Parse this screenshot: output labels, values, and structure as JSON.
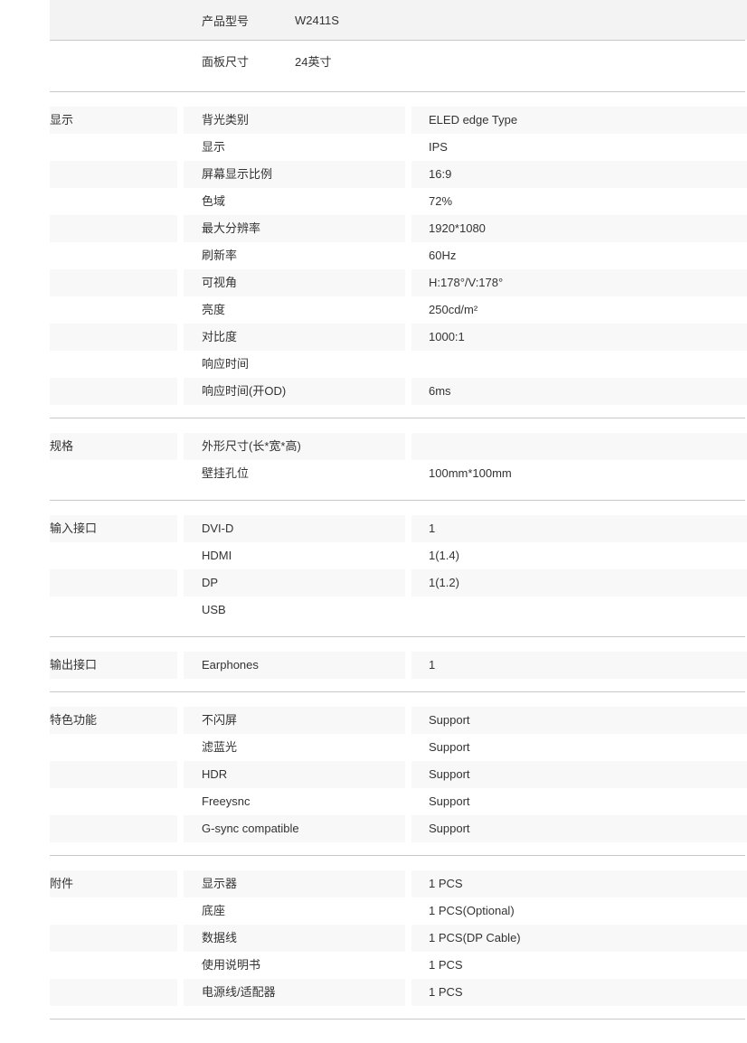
{
  "product": {
    "model_label": "产品型号",
    "model_value": "W2411S",
    "panel_size_label": "面板尺寸",
    "panel_size_value": "24英寸"
  },
  "sections": [
    {
      "group": "显示",
      "rows": [
        {
          "label": "背光类别",
          "value": "ELED edge Type"
        },
        {
          "label": "显示",
          "value": "IPS"
        },
        {
          "label": "屏幕显示比例",
          "value": "16:9"
        },
        {
          "label": "色域",
          "value": "72%"
        },
        {
          "label": "最大分辨率",
          "value": "1920*1080"
        },
        {
          "label": "刷新率",
          "value": "60Hz"
        },
        {
          "label": "可视角",
          "value": "H:178°/V:178°"
        },
        {
          "label": "亮度",
          "value": "250cd/m²"
        },
        {
          "label": "对比度",
          "value": "1000:1"
        },
        {
          "label": "响应时间",
          "value": ""
        },
        {
          "label": "响应时间(开OD)",
          "value": "6ms"
        }
      ]
    },
    {
      "group": "规格",
      "rows": [
        {
          "label": "外形尺寸(长*宽*高)",
          "value": ""
        },
        {
          "label": "壁挂孔位",
          "value": "100mm*100mm"
        }
      ]
    },
    {
      "group": "输入接口",
      "rows": [
        {
          "label": "DVI-D",
          "value": "1"
        },
        {
          "label": "HDMI",
          "value": "1(1.4)"
        },
        {
          "label": "DP",
          "value": "1(1.2)"
        },
        {
          "label": "USB",
          "value": ""
        }
      ]
    },
    {
      "group": "输出接口",
      "rows": [
        {
          "label": "Earphones",
          "value": "1"
        }
      ]
    },
    {
      "group": "特色功能",
      "rows": [
        {
          "label": "不闪屏",
          "value": "Support"
        },
        {
          "label": "滤蓝光",
          "value": "Support"
        },
        {
          "label": "HDR",
          "value": "Support"
        },
        {
          "label": "Freeysnc",
          "value": "Support"
        },
        {
          "label": "G-sync compatible",
          "value": "Support"
        }
      ]
    },
    {
      "group": "附件",
      "rows": [
        {
          "label": "显示器",
          "value": "1 PCS"
        },
        {
          "label": "底座",
          "value": "1 PCS(Optional)"
        },
        {
          "label": "数据线",
          "value": "1 PCS(DP Cable)"
        },
        {
          "label": "使用说明书",
          "value": "1 PCS"
        },
        {
          "label": "电源线/适配器",
          "value": "1 PCS"
        }
      ]
    }
  ],
  "colors": {
    "zebra": "#f8f8f8",
    "lead_band": "#f3f3f3",
    "divider": "#c9c9c9",
    "text": "#333333",
    "page_background": "#ffffff"
  }
}
